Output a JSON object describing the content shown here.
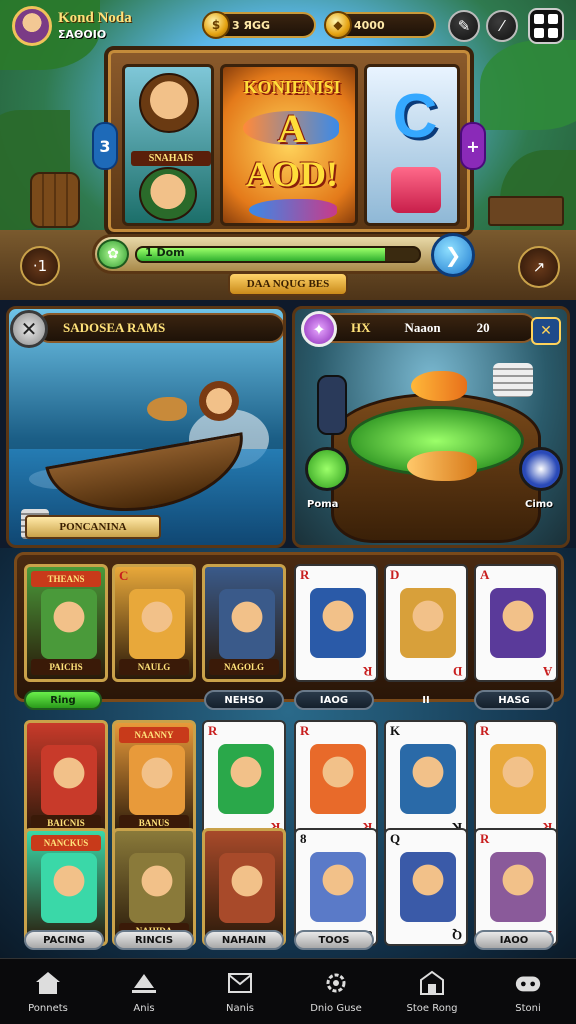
{
  "player": {
    "name": "Kond Noda",
    "subtitle": "ΣΑΘΟΙΟ"
  },
  "currency": [
    {
      "icon": "coin-icon",
      "value": "3 ЯGG"
    },
    {
      "icon": "gem-icon",
      "value": "4000"
    }
  ],
  "header_tools": [
    "pencil-icon",
    "brush-icon",
    "menu-grid-icon"
  ],
  "board": {
    "card1_label": "SNAHAIS",
    "center_title_top": "KONIENISI",
    "center_title_mid": "A",
    "center_title_bottom": "AOD!",
    "right_glyph": "C",
    "left_tab": "3",
    "right_tab": "+"
  },
  "side_buttons": {
    "left": "·1",
    "right": "↗"
  },
  "progress": {
    "label": "1 Dom",
    "fraction": 0.88
  },
  "bottom_label": "DAA NQUG BES",
  "left_panel": {
    "title": "SADOSEA RAMS",
    "footer": "PONCANINA"
  },
  "right_panel": {
    "tag": "HX",
    "title": "Naaon",
    "count": "20",
    "left_orb": "Poma",
    "right_orb": "Cimo"
  },
  "shelf_cards": [
    {
      "type": "pic",
      "caption": "PAICHS",
      "top": "THEANS",
      "art": "#4a9a3a"
    },
    {
      "type": "pic",
      "caption": "NAULG",
      "rank": "C",
      "art": "#e8a83a"
    },
    {
      "type": "pic",
      "caption": "NAGOLG",
      "top": "",
      "art": "#3a5a8a"
    },
    {
      "type": "face",
      "rank": "R",
      "art": "#2a5aa8",
      "black": false
    },
    {
      "type": "face",
      "rank": "D",
      "art": "#d8a03a",
      "black": false
    },
    {
      "type": "face",
      "rank": "A",
      "art": "#5a3a9a",
      "black": false
    }
  ],
  "shelf_pills": [
    "Ring",
    "NEHSO",
    "ΙΑΟG",
    "II",
    "HASG"
  ],
  "row2_cards": [
    {
      "type": "pic",
      "caption": "BAICNIS",
      "art": "#c83a2a"
    },
    {
      "type": "pic",
      "caption": "BANUS",
      "top": "NAANNY",
      "art": "#e89a3a"
    },
    {
      "type": "face",
      "rank": "R",
      "art": "#2aa84a",
      "black": false
    },
    {
      "type": "face",
      "rank": "R",
      "art": "#e86a2a",
      "black": false
    },
    {
      "type": "face",
      "rank": "K",
      "art": "#2a6aa8",
      "black": true
    },
    {
      "type": "face",
      "rank": "R",
      "art": "#e8a83a",
      "black": false
    }
  ],
  "row3_cards": [
    {
      "type": "pic",
      "caption": "",
      "top": "NANCKUS",
      "art": "#3ad8a8"
    },
    {
      "type": "pic",
      "caption": "NAHIDA",
      "art": "#8a7a3a"
    },
    {
      "type": "pic",
      "caption": "",
      "art": "#a84a2a"
    },
    {
      "type": "face",
      "rank": "8",
      "art": "#5a7ac8",
      "black": true
    },
    {
      "type": "face",
      "rank": "Q",
      "art": "#3a5aa8",
      "black": true
    },
    {
      "type": "face",
      "rank": "R",
      "art": "#8a5a9a",
      "black": false
    }
  ],
  "row3_pills": [
    "PACING",
    "RINCIS",
    "NAHAIN",
    "TOOS",
    "ΙΑΟΟ"
  ],
  "nav": [
    {
      "label": "Ponnets",
      "icon": "home-icon"
    },
    {
      "label": "Anis",
      "icon": "hat-icon"
    },
    {
      "label": "Nanis",
      "icon": "mail-icon"
    },
    {
      "label": "Dnio Guse",
      "icon": "gear-icon"
    },
    {
      "label": "Stoe Rong",
      "icon": "store-icon"
    },
    {
      "label": "Stoni",
      "icon": "controller-icon"
    }
  ]
}
